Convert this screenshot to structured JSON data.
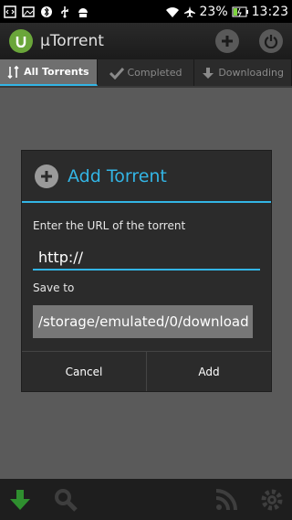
{
  "statusbar": {
    "battery": "23%",
    "time": "13:23",
    "icons": [
      "code-icon",
      "image-icon",
      "bluetooth-icon",
      "usb-icon",
      "android-icon",
      "wifi-icon",
      "airplane-icon",
      "battery-icon"
    ]
  },
  "app": {
    "title": "µTorrent",
    "actions": [
      "add-icon",
      "power-icon"
    ]
  },
  "tabs": [
    {
      "label": "All Torrents",
      "icon": "sort-icon",
      "active": true
    },
    {
      "label": "Completed",
      "icon": "check-icon",
      "active": false
    },
    {
      "label": "Downloading",
      "icon": "download-arrow-icon",
      "active": false
    }
  ],
  "dialog": {
    "title": "Add Torrent",
    "url_label": "Enter the URL of the torrent",
    "url_value": "http://",
    "save_label": "Save to",
    "save_path": "/storage/emulated/0/download",
    "cancel_label": "Cancel",
    "add_label": "Add"
  },
  "bottombar": {
    "icons": [
      "download-icon",
      "search-icon",
      "rss-icon",
      "settings-icon"
    ]
  },
  "colors": {
    "accent": "#33b5e5",
    "logo_green": "#6aa63a"
  }
}
